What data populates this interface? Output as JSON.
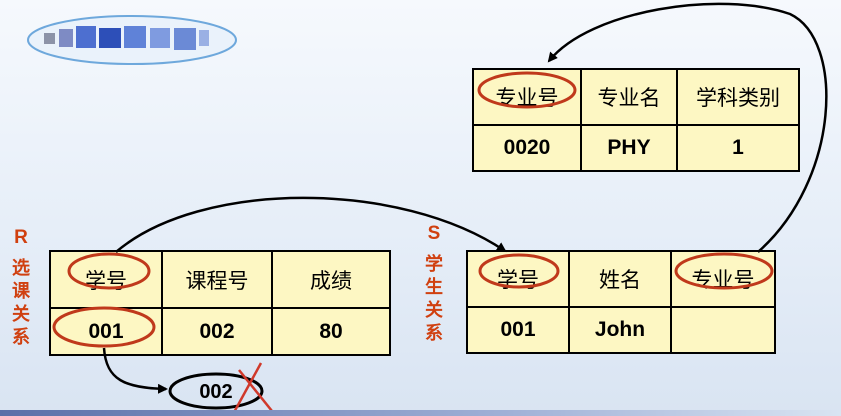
{
  "relation_r": {
    "letter": "R",
    "name": "选课关系",
    "headers": [
      "学号",
      "课程号",
      "成绩"
    ],
    "row": [
      "001",
      "002",
      "80"
    ]
  },
  "relation_s": {
    "letter": "S",
    "name": "学生关系",
    "headers": [
      "学号",
      "姓名",
      "专业号"
    ],
    "row": [
      "001",
      "John",
      ""
    ]
  },
  "relation_major": {
    "headers": [
      "专业号",
      "专业名",
      "学科类别"
    ],
    "row": [
      "0020",
      "PHY",
      "1"
    ]
  },
  "rejected_value": "002",
  "colors": {
    "highlight_ellipse": "#c0391b",
    "cross_out": "#d0392b",
    "table_fill": "#fdf7c3",
    "side_label": "#d04010",
    "arrow": "#000000"
  }
}
